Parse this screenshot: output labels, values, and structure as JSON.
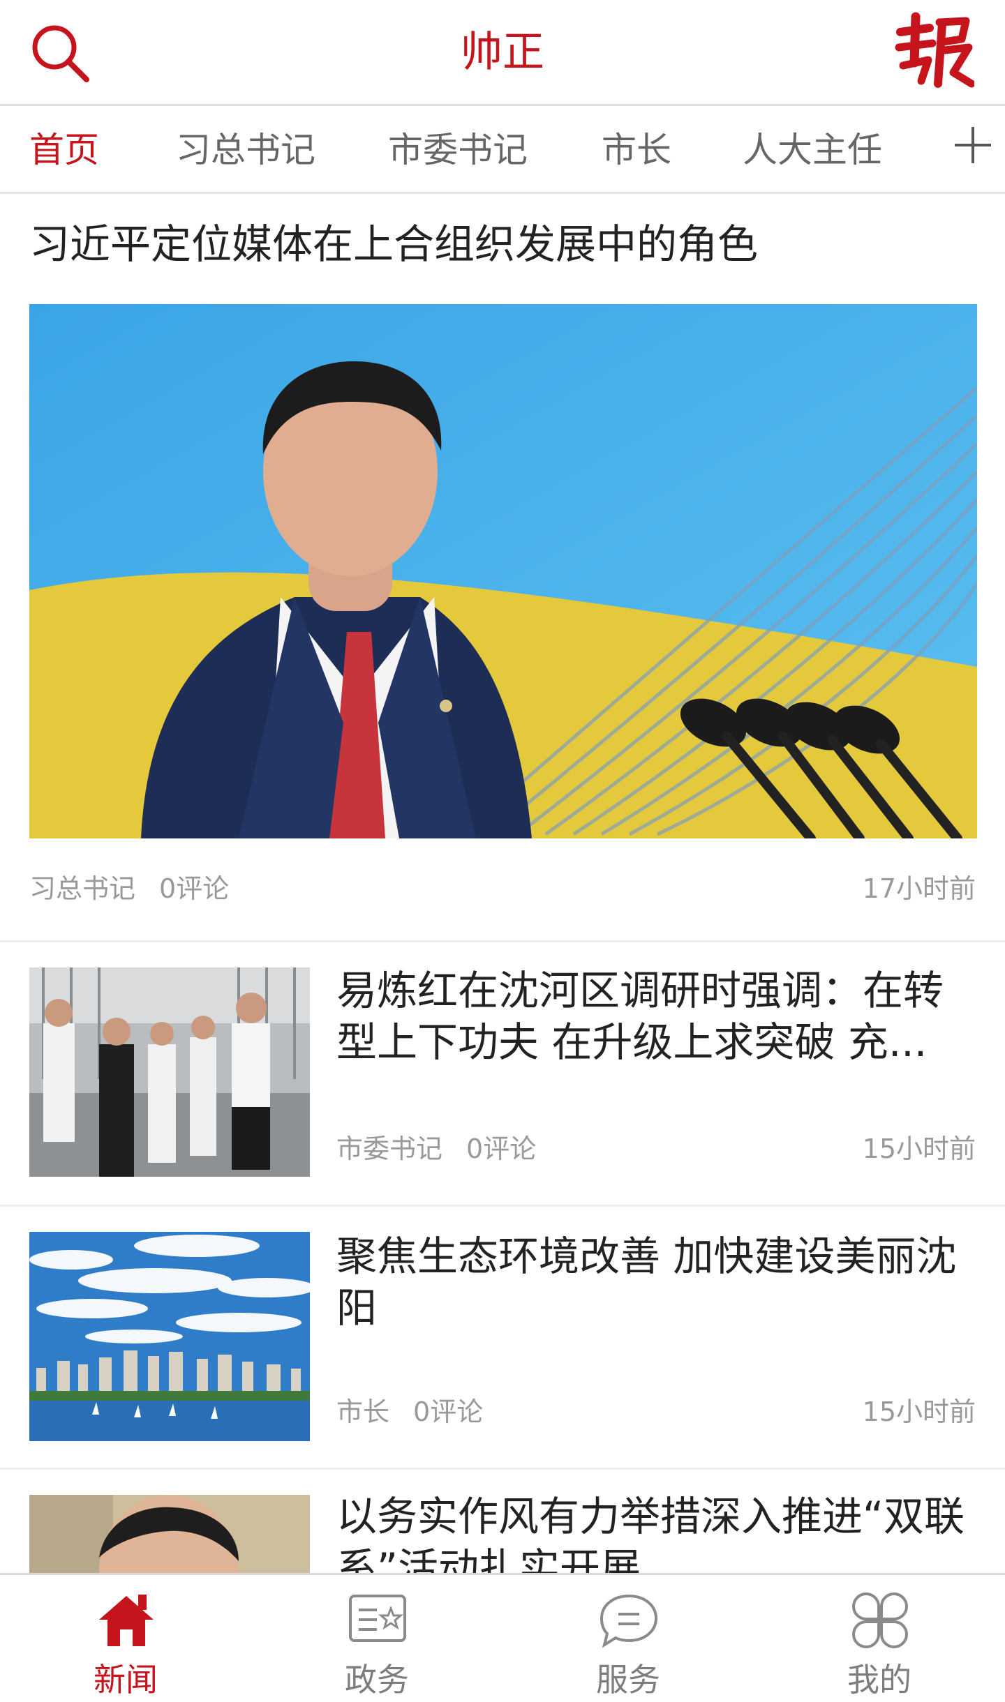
{
  "header": {
    "title": "帅正",
    "logo_icon": "bao-logo-icon",
    "search_icon": "search-icon"
  },
  "tabs": [
    {
      "label": "首页",
      "active": true
    },
    {
      "label": "习总书记",
      "active": false
    },
    {
      "label": "市委书记",
      "active": false
    },
    {
      "label": "市长",
      "active": false
    },
    {
      "label": "人大主任",
      "active": false
    }
  ],
  "tabs_add_icon": "plus-icon",
  "feed": {
    "lead": {
      "title": "习近平定位媒体在上合组织发展中的角色",
      "category": "习总书记",
      "comments": "0评论",
      "time": "17小时前"
    },
    "items": [
      {
        "title": "易炼红在沈河区调研时强调：在转型上下功夫 在升级上求突破 充...",
        "category": "市委书记",
        "comments": "0评论",
        "time": "15小时前"
      },
      {
        "title": "聚焦生态环境改善 加快建设美丽沈阳",
        "category": "市长",
        "comments": "0评论",
        "time": "15小时前"
      },
      {
        "title": "以务实作风有力举措深入推进“双联系”活动扎实开展",
        "category": "",
        "comments": "",
        "time": ""
      }
    ]
  },
  "bottom_nav": [
    {
      "label": "新闻",
      "icon": "home-icon",
      "active": true
    },
    {
      "label": "政务",
      "icon": "document-star-icon",
      "active": false
    },
    {
      "label": "服务",
      "icon": "chat-bubble-icon",
      "active": false
    },
    {
      "label": "我的",
      "icon": "clover-grid-icon",
      "active": false
    }
  ],
  "colors": {
    "accent": "#c5141b",
    "inactive_text": "#7d7d7d",
    "meta_text": "#999999"
  }
}
